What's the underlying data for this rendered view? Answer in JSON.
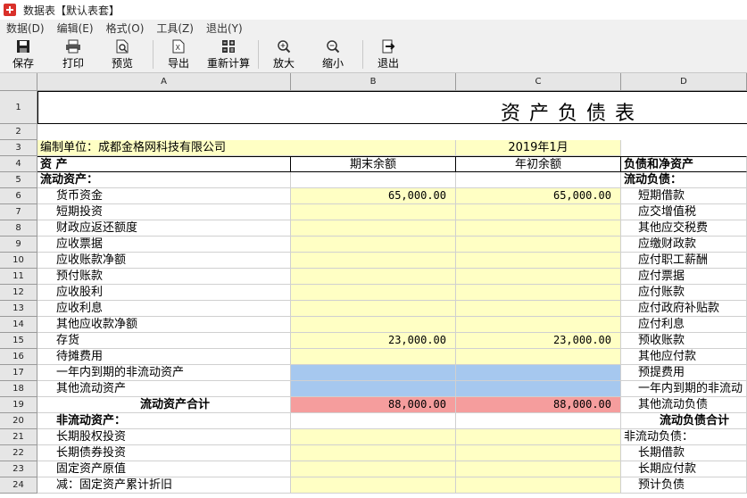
{
  "window": {
    "title": "数据表【默认表套】"
  },
  "menu": [
    "数据(D)",
    "编辑(E)",
    "格式(O)",
    "工具(Z)",
    "退出(Y)"
  ],
  "toolbar": {
    "save": "保存",
    "print": "打印",
    "preview": "预览",
    "export": "导出",
    "recalc": "重新计算",
    "zoom_in": "放大",
    "zoom_out": "缩小",
    "exit": "退出"
  },
  "columns": [
    "A",
    "B",
    "C",
    "D"
  ],
  "sheet": {
    "title": "资产负债表",
    "unit_label": "编制单位：成都金格网科技有限公司",
    "period": "2019年1月",
    "header": {
      "assets": "资    产",
      "ending": "期末余额",
      "beginning": "年初余额",
      "liabilities": "负债和净资产"
    },
    "rows": [
      {
        "n": "1"
      },
      {
        "n": "2"
      },
      {
        "n": "3"
      },
      {
        "n": "4"
      },
      {
        "n": "5",
        "a": "流动资产：",
        "d": "流动负债："
      },
      {
        "n": "6",
        "a": "货币资金",
        "b": "65,000.00",
        "c": "65,000.00",
        "d": "短期借款"
      },
      {
        "n": "7",
        "a": "短期投资",
        "d": "应交增值税"
      },
      {
        "n": "8",
        "a": "财政应返还额度",
        "d": "其他应交税费"
      },
      {
        "n": "9",
        "a": "应收票据",
        "d": "应缴财政款"
      },
      {
        "n": "10",
        "a": "应收账款净额",
        "d": "应付职工薪酬"
      },
      {
        "n": "11",
        "a": "预付账款",
        "d": "应付票据"
      },
      {
        "n": "12",
        "a": "应收股利",
        "d": "应付账款"
      },
      {
        "n": "13",
        "a": "应收利息",
        "d": "应付政府补贴款"
      },
      {
        "n": "14",
        "a": "其他应收款净额",
        "d": "应付利息"
      },
      {
        "n": "15",
        "a": "存货",
        "b": "23,000.00",
        "c": "23,000.00",
        "d": "预收账款"
      },
      {
        "n": "16",
        "a": "待摊费用",
        "d": "其他应付款"
      },
      {
        "n": "17",
        "a": "一年内到期的非流动资产",
        "d": "预提费用"
      },
      {
        "n": "18",
        "a": "其他流动资产",
        "d": "一年内到期的非流动"
      },
      {
        "n": "19",
        "a": "流动资产合计",
        "b": "88,000.00",
        "c": "88,000.00",
        "d": "其他流动负债"
      },
      {
        "n": "20",
        "a": "非流动资产：",
        "d": "流动负债合计"
      },
      {
        "n": "21",
        "a": "长期股权投资",
        "d": "非流动负债："
      },
      {
        "n": "22",
        "a": "长期债券投资",
        "d": "长期借款"
      },
      {
        "n": "23",
        "a": "固定资产原值",
        "d": "长期应付款"
      },
      {
        "n": "24",
        "a": "减：固定资产累计折旧",
        "d": "预计负债"
      }
    ]
  }
}
